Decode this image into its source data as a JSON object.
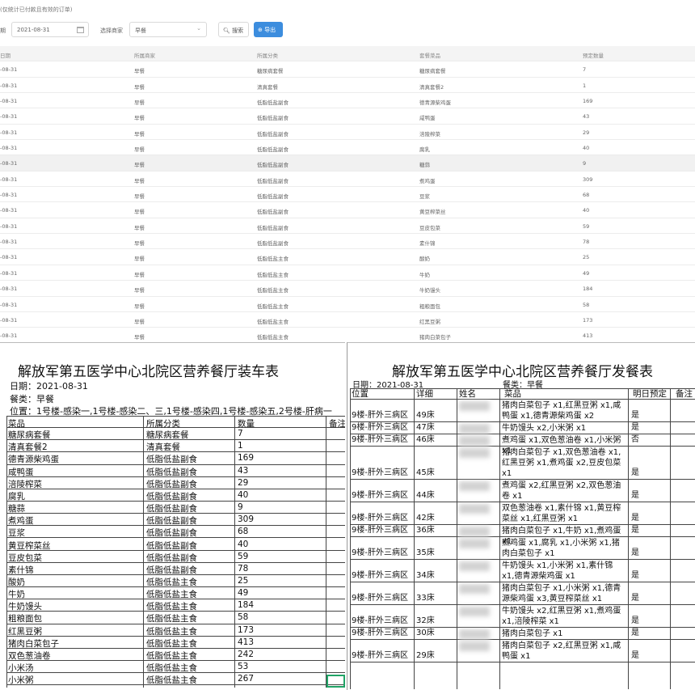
{
  "web": {
    "note": "(仅统计已付款且有效的订单)",
    "date_label": "期",
    "date_value": "2021-08-31",
    "shop_label": "选择商家",
    "shop_value": "早餐",
    "search_label": "搜索",
    "export_label": "导出",
    "columns": [
      "日期",
      "所属商家",
      "所属分类",
      "套餐菜品",
      "预定数量"
    ],
    "rows": [
      [
        "-08-31",
        "早餐",
        "糖尿病套餐",
        "糖尿病套餐",
        "7"
      ],
      [
        "-08-31",
        "早餐",
        "清真套餐",
        "清真套餐2",
        "1"
      ],
      [
        "-08-31",
        "早餐",
        "低脂低盐副食",
        "德青源柴鸡蛋",
        "169"
      ],
      [
        "-08-31",
        "早餐",
        "低脂低盐副食",
        "咸鸭蛋",
        "43"
      ],
      [
        "-08-31",
        "早餐",
        "低脂低盐副食",
        "涪陵榨菜",
        "29"
      ],
      [
        "-08-31",
        "早餐",
        "低脂低盐副食",
        "腐乳",
        "40"
      ],
      [
        "-08-31",
        "早餐",
        "低脂低盐副食",
        "糖蒜",
        "9"
      ],
      [
        "-08-31",
        "早餐",
        "低脂低盐副食",
        "煮鸡蛋",
        "309"
      ],
      [
        "-08-31",
        "早餐",
        "低脂低盐副食",
        "豆浆",
        "68"
      ],
      [
        "-08-31",
        "早餐",
        "低脂低盐副食",
        "黄豆榨菜丝",
        "40"
      ],
      [
        "-08-31",
        "早餐",
        "低脂低盐副食",
        "豆皮包菜",
        "59"
      ],
      [
        "-08-31",
        "早餐",
        "低脂低盐副食",
        "素什锦",
        "78"
      ],
      [
        "-08-31",
        "早餐",
        "低脂低盐主食",
        "酸奶",
        "25"
      ],
      [
        "-08-31",
        "早餐",
        "低脂低盐主食",
        "牛奶",
        "49"
      ],
      [
        "-08-31",
        "早餐",
        "低脂低盐主食",
        "牛奶馒头",
        "184"
      ],
      [
        "-08-31",
        "早餐",
        "低脂低盐主食",
        "粗粮面包",
        "58"
      ],
      [
        "-08-31",
        "早餐",
        "低脂低盐主食",
        "红黑豆粥",
        "173"
      ],
      [
        "-08-31",
        "早餐",
        "低脂低盐主食",
        "猪肉白菜包子",
        "413"
      ]
    ]
  },
  "sheet1": {
    "title": "解放军第五医学中心北院区营养餐厅装车表",
    "date_line": "日期：2021-08-31",
    "meal_line": "餐类：早餐",
    "location_line": "位置：1号楼-感染一,1号楼-感染二、三,1号楼-感染四,1号楼-感染五,2号楼-肝病一",
    "columns": [
      "菜品",
      "所属分类",
      "数量",
      "备注"
    ],
    "rows": [
      [
        "糖尿病套餐",
        "糖尿病套餐",
        "7"
      ],
      [
        "清真套餐2",
        "清真套餐",
        "1"
      ],
      [
        "德青源柴鸡蛋",
        "低脂低盐副食",
        "169"
      ],
      [
        "咸鸭蛋",
        "低脂低盐副食",
        "43"
      ],
      [
        "涪陵榨菜",
        "低脂低盐副食",
        "29"
      ],
      [
        "腐乳",
        "低脂低盐副食",
        "40"
      ],
      [
        "糖蒜",
        "低脂低盐副食",
        "9"
      ],
      [
        "煮鸡蛋",
        "低脂低盐副食",
        "309"
      ],
      [
        "豆浆",
        "低脂低盐副食",
        "68"
      ],
      [
        "黄豆榨菜丝",
        "低脂低盐副食",
        "40"
      ],
      [
        "豆皮包菜",
        "低脂低盐副食",
        "59"
      ],
      [
        "素什锦",
        "低脂低盐副食",
        "78"
      ],
      [
        "酸奶",
        "低脂低盐主食",
        "25"
      ],
      [
        "牛奶",
        "低脂低盐主食",
        "49"
      ],
      [
        "牛奶馒头",
        "低脂低盐主食",
        "184"
      ],
      [
        "粗粮面包",
        "低脂低盐主食",
        "58"
      ],
      [
        "红黑豆粥",
        "低脂低盐主食",
        "173"
      ],
      [
        "猪肉白菜包子",
        "低脂低盐主食",
        "413"
      ],
      [
        "双色葱油卷",
        "低脂低盐主食",
        "242"
      ],
      [
        "小米汤",
        "低脂低盐主食",
        "53"
      ],
      [
        "小米粥",
        "低脂低盐主食",
        "267"
      ]
    ]
  },
  "sheet2": {
    "title": "解放军第五医学中心北院区营养餐厅发餐表",
    "date_line": "日期：2021-08-31",
    "meal_line": "餐类：早餐",
    "columns": [
      "位置",
      "详细",
      "姓名",
      "菜品",
      "明日预定",
      "备注"
    ],
    "rows": [
      [
        "9楼-肝外三病区",
        "49床",
        "猪肉白菜包子 x1,红黑豆粥 x1,咸鸭蛋 x1,德青源柴鸡蛋 x2",
        "是"
      ],
      [
        "9楼-肝外三病区",
        "47床",
        "牛奶馒头 x2,小米粥 x1",
        "是"
      ],
      [
        "9楼-肝外三病区",
        "46床",
        "煮鸡蛋 x1,双色葱油卷 x1,小米粥 x1",
        "否"
      ],
      [
        "9楼-肝外三病区",
        "45床",
        "猪肉白菜包子 x1,双色葱油卷 x1,红黑豆粥 x1,煮鸡蛋 x2,豆皮包菜 x1",
        "是"
      ],
      [
        "9楼-肝外三病区",
        "44床",
        "煮鸡蛋 x2,红黑豆粥 x2,双色葱油卷 x1",
        "是"
      ],
      [
        "9楼-肝外三病区",
        "42床",
        "双色葱油卷 x1,素什锦 x1,黄豆榨菜丝 x1,红黑豆粥 x1",
        "是"
      ],
      [
        "9楼-肝外三病区",
        "36床",
        "猪肉白菜包子 x1,牛奶 x1,煮鸡蛋 x1",
        "是"
      ],
      [
        "9楼-肝外三病区",
        "35床",
        "煮鸡蛋 x1,腐乳 x1,小米粥 x1,猪肉白菜包子 x1",
        "是"
      ],
      [
        "9楼-肝外三病区",
        "34床",
        "牛奶馒头 x1,小米粥 x1,素什锦 x1,德青源柴鸡蛋 x1",
        "是"
      ],
      [
        "9楼-肝外三病区",
        "33床",
        "猪肉白菜包子 x1,小米粥 x1,德青源柴鸡蛋 x3,黄豆榨菜丝 x1",
        "是"
      ],
      [
        "9楼-肝外三病区",
        "32床",
        "牛奶馒头 x2,红黑豆粥 x1,煮鸡蛋 x1,涪陵榨菜 x1",
        "是"
      ],
      [
        "9楼-肝外三病区",
        "30床",
        "猪肉白菜包子 x1",
        "是"
      ],
      [
        "9楼-肝外三病区",
        "29床",
        "猪肉白菜包子 x2,红黑豆粥 x1,咸鸭蛋 x1",
        "是"
      ]
    ]
  }
}
